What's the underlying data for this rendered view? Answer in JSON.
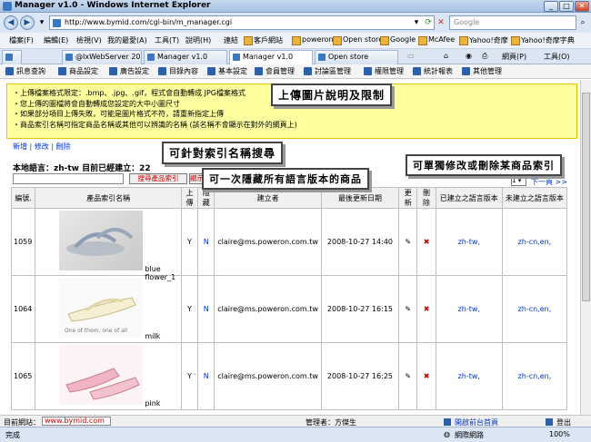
{
  "window": {
    "title": "Manager v1.0 - Windows Internet Explorer"
  },
  "browser": {
    "address": "http://www.bymid.com/cgi-bin/m_manager.cgi",
    "search_placeholder": "Google",
    "menu": [
      "檔案(F)",
      "編輯(E)",
      "檢視(V)",
      "我的最愛(A)",
      "工具(T)",
      "說明(H)"
    ],
    "favorites_label": "連結",
    "favorites": [
      "客戶網站",
      "poweron",
      "Open store",
      "Google",
      "McAfee",
      "Yahoo!奇摩",
      "Yahoo!奇摩字典"
    ],
    "tabs": [
      "@IxWebServer 2007 ...",
      "Manager v1.0",
      "Manager v1.0",
      "Open store"
    ],
    "tools": [
      "網頁(P)",
      "工具(O)"
    ],
    "status_left": "完成",
    "status_zone": "網際網路",
    "zoom": "100%"
  },
  "appnav": [
    "訊息查詢",
    "商品設定",
    "廣告設定",
    "目錄內容",
    "基本設定",
    "會員管理",
    "討論區管理",
    "權限管理",
    "統計報表",
    "其他管理"
  ],
  "notice": [
    "・上傳檔案格式限定：.bmp、.jpg、.gif，程式會自動轉成 JPG檔案格式",
    "・您上傳的圖檔將會自動轉成您設定的大中小圖尺寸",
    "・如果部分項目上傳失敗，可能是圖片格式不符，請重新指定上傳",
    "・商品索引名稱可指定商品名稱或其他可以辨識的名稱 (該名稱不會顯示在對外的網頁上)"
  ],
  "links": {
    "add": "新增",
    "edit": "修改",
    "delete": "刪除",
    "sep": "|"
  },
  "lang_total": {
    "prefix": "本地語言：zh-tw 目前已經建立：",
    "count": "22"
  },
  "search": {
    "button": "搜尋產品索引",
    "show": "顯示"
  },
  "pager": {
    "page": "1",
    "next": "下一頁 >>"
  },
  "table": {
    "headers": [
      "編號.",
      "產品索引名稱",
      "上傳",
      "隱藏",
      "建立者",
      "最後更新日期",
      "更新",
      "刪除",
      "已建立之語言版本",
      "未建立之語言版本"
    ],
    "rows": [
      {
        "id": "1059",
        "name": "blue flower_1",
        "upload": "Y",
        "hidden": "N",
        "creator": "claire@ms.poweron.com.tw",
        "updated": "2008-10-27 14:40",
        "langs_done": "zh-tw,",
        "langs_todo": "zh-cn,en,"
      },
      {
        "id": "1064",
        "name": "milk",
        "upload": "Y",
        "hidden": "N",
        "creator": "claire@ms.poweron.com.tw",
        "updated": "2008-10-27 16:15",
        "langs_done": "zh-tw,",
        "langs_todo": "zh-cn,en,"
      },
      {
        "id": "1065",
        "name": "pink",
        "upload": "Y",
        "hidden": "N",
        "creator": "claire@ms.poweron.com.tw",
        "updated": "2008-10-27 16:25",
        "langs_done": "zh-tw,",
        "langs_todo": "zh-cn,en,"
      }
    ]
  },
  "footer": {
    "site_label": "目前網站：",
    "site_value": "www.bymid.com",
    "manager": "管理者：方傑生",
    "front_link": "開啟前台首頁",
    "logout": "登出"
  },
  "callouts": {
    "upload": "上傳圖片說明及限制",
    "search": "可針對索引名稱搜尋",
    "hide": "可一次隱藏所有語言版本的商品",
    "edit": "可單獨修改或刪除某商品索引"
  },
  "colors": {
    "notice_bg": "#ffffa0",
    "link": "#0033cc",
    "accent": "#cc0000"
  }
}
